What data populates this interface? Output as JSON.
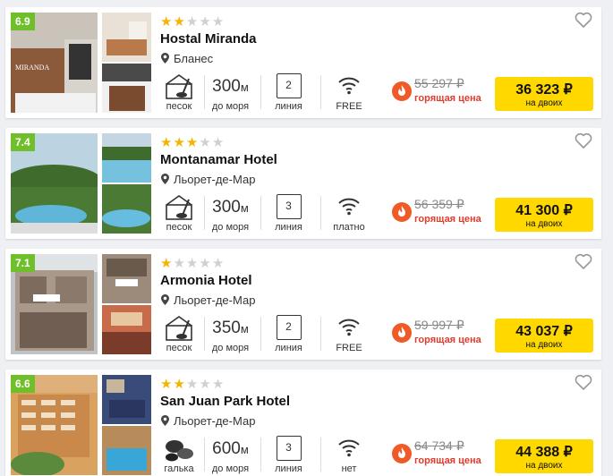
{
  "hotels": [
    {
      "rating": "6.9",
      "stars_on": 2,
      "name": "Hostal Miranda",
      "city": "Бланес",
      "beach": "песок",
      "distance": "300",
      "distance_unit": "м",
      "distance_caption": "до моря",
      "line": "2",
      "line_caption": "линия",
      "wifi": "FREE",
      "old_price": "55 297 ₽",
      "hot_label": "горящая цена",
      "price": "36 323 ₽",
      "price_caption": "на двоих"
    },
    {
      "rating": "7.4",
      "stars_on": 3,
      "name": "Montanamar Hotel",
      "city": "Льорет-де-Мар",
      "beach": "песок",
      "distance": "300",
      "distance_unit": "м",
      "distance_caption": "до моря",
      "line": "3",
      "line_caption": "линия",
      "wifi": "платно",
      "old_price": "56 359 ₽",
      "hot_label": "горящая цена",
      "price": "41 300 ₽",
      "price_caption": "на двоих"
    },
    {
      "rating": "7.1",
      "stars_on": 1,
      "name": "Armonia Hotel",
      "city": "Льорет-де-Мар",
      "beach": "песок",
      "distance": "350",
      "distance_unit": "м",
      "distance_caption": "до моря",
      "line": "2",
      "line_caption": "линия",
      "wifi": "FREE",
      "old_price": "59 997 ₽",
      "hot_label": "горящая цена",
      "price": "43 037 ₽",
      "price_caption": "на двоих"
    },
    {
      "rating": "6.6",
      "stars_on": 2,
      "name": "San Juan Park Hotel",
      "city": "Льорет-де-Мар",
      "beach": "галька",
      "distance": "600",
      "distance_unit": "м",
      "distance_caption": "до моря",
      "line": "3",
      "line_caption": "линия",
      "wifi": "нет",
      "old_price": "64 734 ₽",
      "hot_label": "горящая цена",
      "price": "44 388 ₽",
      "price_caption": "на двоих"
    }
  ],
  "photo_sign": "MIRANDA",
  "colors": {
    "rating_bg": "#6fbf2a",
    "star": "#f5b400",
    "price_button": "#ffd800",
    "hot": "#e23b2c"
  }
}
